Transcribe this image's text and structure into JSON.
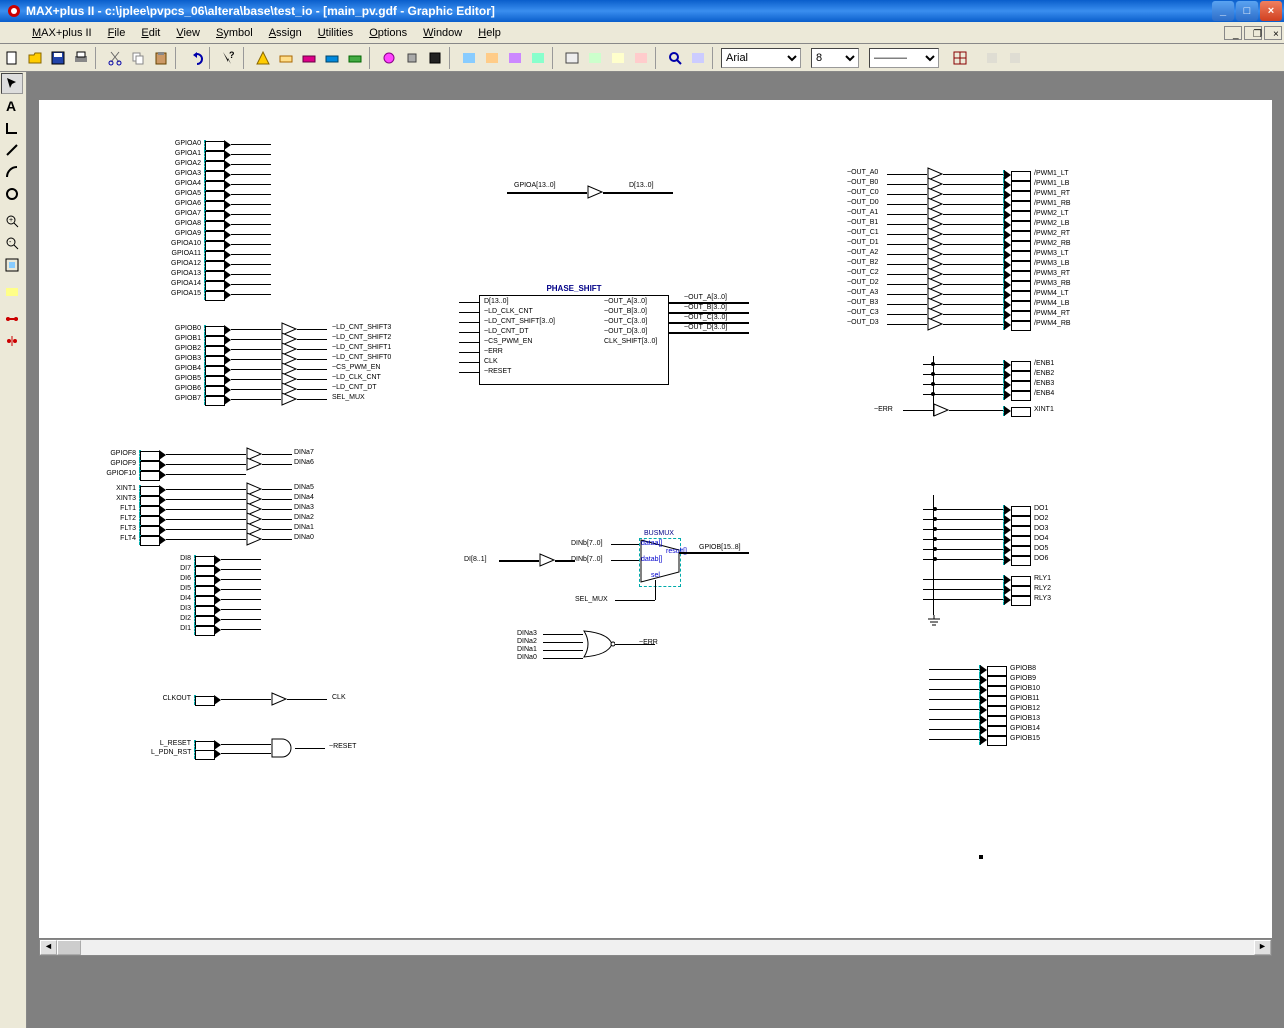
{
  "window": {
    "title": "MAX+plus II - c:\\jplee\\pvpcs_06\\altera\\base\\test_io - [main_pv.gdf - Graphic Editor]"
  },
  "menus": {
    "m0": "MAX+plus II",
    "m1": "File",
    "m2": "Edit",
    "m3": "View",
    "m4": "Symbol",
    "m5": "Assign",
    "m6": "Utilities",
    "m7": "Options",
    "m8": "Window",
    "m9": "Help"
  },
  "toolbar": {
    "font": "Arial",
    "size": "8",
    "linestyle": "———"
  },
  "pins_gpioa": [
    "GPIOA0",
    "GPIOA1",
    "GPIOA2",
    "GPIOA3",
    "GPIOA4",
    "GPIOA5",
    "GPIOA6",
    "GPIOA7",
    "GPIOA8",
    "GPIOA9",
    "GPIOA10",
    "GPIOA11",
    "GPIOA12",
    "GPIOA13",
    "GPIOA14",
    "GPIOA15"
  ],
  "pins_gpiob": [
    "GPIOB0",
    "GPIOB1",
    "GPIOB2",
    "GPIOB3",
    "GPIOB4",
    "GPIOB5",
    "GPIOB6",
    "GPIOB7"
  ],
  "gpiob_net": [
    "~LD_CNT_SHIFT3",
    "~LD_CNT_SHIFT2",
    "~LD_CNT_SHIFT1",
    "~LD_CNT_SHIFT0",
    "~CS_PWM_EN",
    "~LD_CLK_CNT",
    "~LD_CNT_DT",
    "SEL_MUX"
  ],
  "grp_f": [
    "GPIOF8",
    "GPIOF9",
    "GPIOF10"
  ],
  "grp_f_net": [
    "DINa7",
    "DINa6"
  ],
  "grp_xf": [
    "XINT1",
    "XINT3",
    "FLT1",
    "FLT2",
    "FLT3",
    "FLT4"
  ],
  "grp_xf_net": [
    "DINa5",
    "DINa4",
    "DINa3",
    "DINa2",
    "DINa1",
    "DINa0"
  ],
  "grp_di": [
    "DI8",
    "DI7",
    "DI6",
    "DI5",
    "DI4",
    "DI3",
    "DI2",
    "DI1"
  ],
  "clk_in": "CLKOUT",
  "clk_out": "CLK",
  "rst_in": [
    "L_RESET",
    "L_PDN_RST"
  ],
  "rst_out": "~RESET",
  "mid_in": "GPIOA[13..0]",
  "mid_out": "D[13..0]",
  "phase_shift": {
    "title": "PHASE_SHIFT",
    "left": [
      "D[13..0]",
      "~LD_CLK_CNT",
      "~LD_CNT_SHIFT[3..0]",
      "~LD_CNT_DT",
      "~CS_PWM_EN",
      "~ERR",
      "CLK",
      "~RESET"
    ],
    "right": [
      "~OUT_A[3..0]",
      "~OUT_B[3..0]",
      "~OUT_C[3..0]",
      "~OUT_D[3..0]",
      "CLK_SHIFT[3..0]"
    ],
    "wires_out": [
      "~OUT_A[3..0]",
      "~OUT_B[3..0]",
      "~OUT_C[3..0]",
      "~OUT_D[3..0]"
    ]
  },
  "right_out_left": [
    "~OUT_A0",
    "~OUT_B0",
    "~OUT_C0",
    "~OUT_D0",
    "~OUT_A1",
    "~OUT_B1",
    "~OUT_C1",
    "~OUT_D1",
    "~OUT_A2",
    "~OUT_B2",
    "~OUT_C2",
    "~OUT_D2",
    "~OUT_A3",
    "~OUT_B3",
    "~OUT_C3",
    "~OUT_D3"
  ],
  "right_out_right": [
    "/PWM1_LT",
    "/PWM1_LB",
    "/PWM1_RT",
    "/PWM1_RB",
    "/PWM2_LT",
    "/PWM2_LB",
    "/PWM2_RT",
    "/PWM2_RB",
    "/PWM3_LT",
    "/PWM3_LB",
    "/PWM3_RT",
    "/PWM3_RB",
    "/PWM4_LT",
    "/PWM4_LB",
    "/PWM4_RT",
    "/PWM4_RB"
  ],
  "enb": [
    "/ENB1",
    "/ENB2",
    "/ENB3",
    "/ENB4"
  ],
  "enb_err_in": "~ERR",
  "enb_xint": "XINT1",
  "busmux": {
    "title": "BUSMUX",
    "ina": "DINb[7..0]",
    "inb": "DINb[7..0]",
    "ina_lbl": "dataa[]",
    "inb_lbl": "datab[]",
    "sel": "sel",
    "out": "result[]",
    "res": "GPIOB[15..8]",
    "in_src": "DI[8..1]",
    "sel_net": "SEL_MUX"
  },
  "err_gate": {
    "ins": [
      "DINa3",
      "DINa2",
      "DINa1",
      "DINa0"
    ],
    "out": "~ERR"
  },
  "do": [
    "DO1",
    "DO2",
    "DO3",
    "DO4",
    "DO5",
    "DO6"
  ],
  "rly": [
    "RLY1",
    "RLY2",
    "RLY3"
  ],
  "gpiob_out": [
    "GPIOB8",
    "GPIOB9",
    "GPIOB10",
    "GPIOB11",
    "GPIOB12",
    "GPIOB13",
    "GPIOB14",
    "GPIOB15"
  ]
}
